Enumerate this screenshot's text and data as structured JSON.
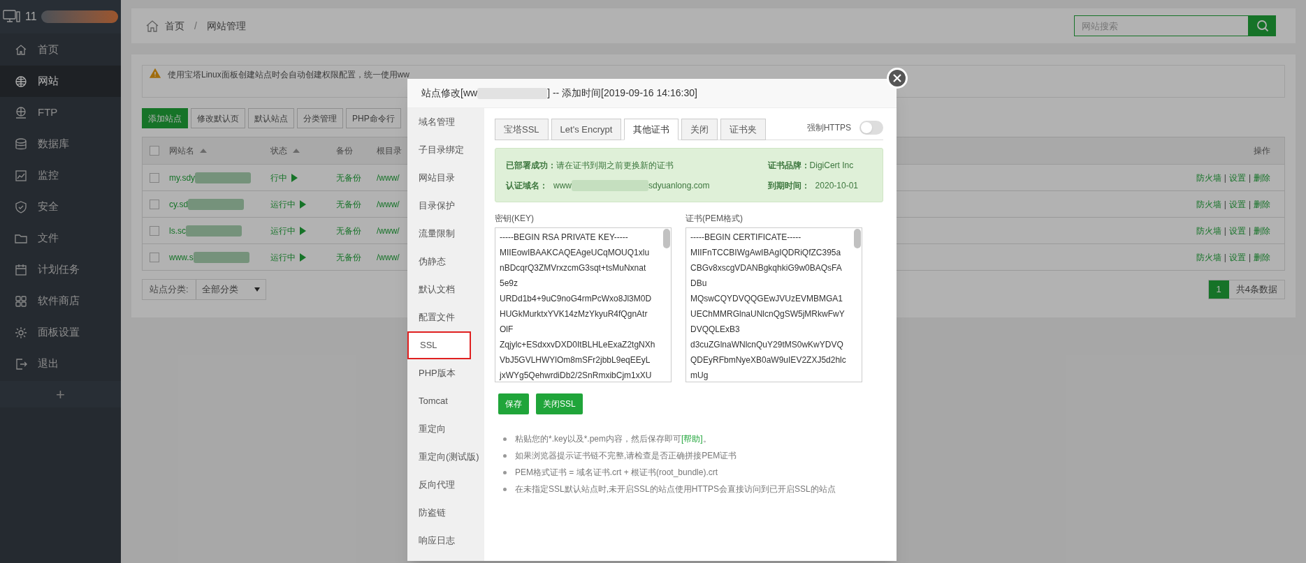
{
  "sidebar": {
    "host": "11",
    "items": [
      {
        "label": "首页",
        "selected": false
      },
      {
        "label": "网站",
        "selected": true
      },
      {
        "label": "FTP",
        "selected": false
      },
      {
        "label": "数据库",
        "selected": false
      },
      {
        "label": "监控",
        "selected": false
      },
      {
        "label": "安全",
        "selected": false
      },
      {
        "label": "文件",
        "selected": false
      },
      {
        "label": "计划任务",
        "selected": false
      },
      {
        "label": "软件商店",
        "selected": false
      },
      {
        "label": "面板设置",
        "selected": false
      },
      {
        "label": "退出",
        "selected": false
      }
    ],
    "add_button": "+"
  },
  "breadcrumb": {
    "items": [
      "首页",
      "网站管理"
    ],
    "separator": "/"
  },
  "search": {
    "placeholder": "网站搜索"
  },
  "notice": "使用宝塔Linux面板创建站点时会自动创建权限配置，统一使用ww",
  "toolbar": [
    {
      "label": "添加站点",
      "primary": true
    },
    {
      "label": "修改默认页",
      "primary": false
    },
    {
      "label": "默认站点",
      "primary": false
    },
    {
      "label": "分类管理",
      "primary": false
    },
    {
      "label": "PHP命令行",
      "primary": false
    }
  ],
  "table": {
    "columns": [
      {
        "label": "网站名",
        "sortable": true
      },
      {
        "label": "状态",
        "sortable": true
      },
      {
        "label": "备份",
        "sortable": false
      },
      {
        "label": "根目录",
        "sortable": false
      },
      {
        "label": "操作",
        "sortable": false
      }
    ],
    "action_separator": "|",
    "all_checked": false,
    "rows": [
      {
        "checked": false,
        "name": "my.sdy",
        "status": "行中",
        "backup": "无备份",
        "path": "/www/",
        "actions": [
          "防火墙",
          "设置",
          "删除"
        ]
      },
      {
        "checked": false,
        "name": "cy.sd",
        "status": "运行中",
        "backup": "无备份",
        "path": "/www/",
        "actions": [
          "防火墙",
          "设置",
          "删除"
        ]
      },
      {
        "checked": false,
        "name": "ls.sc",
        "status": "运行中",
        "backup": "无备份",
        "path": "/www/",
        "actions": [
          "防火墙",
          "设置",
          "删除"
        ]
      },
      {
        "checked": false,
        "name": "www.s",
        "status": "运行中",
        "backup": "无备份",
        "path": "/www/",
        "actions": [
          "防火墙",
          "设置",
          "删除"
        ]
      }
    ]
  },
  "category_filter": {
    "label": "站点分类:",
    "value": "全部分类"
  },
  "pagination": {
    "pages": [
      {
        "label": "1",
        "selected": true
      }
    ],
    "summary": "共4条数据"
  },
  "modal": {
    "title_prefix": "站点修改[ww",
    "title_suffix": "] -- 添加时间[2019-09-16 14:16:30]",
    "menu": [
      {
        "label": "域名管理",
        "selected": false
      },
      {
        "label": "子目录绑定",
        "selected": false
      },
      {
        "label": "网站目录",
        "selected": false
      },
      {
        "label": "目录保护",
        "selected": false
      },
      {
        "label": "流量限制",
        "selected": false
      },
      {
        "label": "伪静态",
        "selected": false
      },
      {
        "label": "默认文档",
        "selected": false
      },
      {
        "label": "配置文件",
        "selected": false
      },
      {
        "label": "SSL",
        "selected": true
      },
      {
        "label": "PHP版本",
        "selected": false
      },
      {
        "label": "Tomcat",
        "selected": false
      },
      {
        "label": "重定向",
        "selected": false
      },
      {
        "label": "重定向(测试版)",
        "selected": false
      },
      {
        "label": "反向代理",
        "selected": false
      },
      {
        "label": "防盗链",
        "selected": false
      },
      {
        "label": "响应日志",
        "selected": false
      }
    ],
    "tabs": [
      {
        "label": "宝塔SSL",
        "selected": false
      },
      {
        "label": "Let's Encrypt",
        "selected": false
      },
      {
        "label": "其他证书",
        "selected": true
      },
      {
        "label": "关闭",
        "selected": false
      },
      {
        "label": "证书夹",
        "selected": false
      }
    ],
    "force_https": {
      "label": "强制HTTPS",
      "on": false
    },
    "status": {
      "deployed_label": "已部署成功：",
      "deployed_text": "请在证书到期之前更换新的证书",
      "domain_label": "认证域名：",
      "domain_prefix": "www",
      "domain_suffix": "sdyuanlong.com",
      "brand_label": "证书品牌：",
      "brand": "DigiCert Inc",
      "expiry_label": "到期时间：",
      "expiry": "2020-10-01"
    },
    "key": {
      "label": "密钥(KEY)",
      "lines": [
        "-----BEGIN RSA PRIVATE KEY-----",
        "MIIEowIBAAKCAQEAgeUCqMOUQ1xlu",
        "nBDcqrQ3ZMVrxzcmG3sqt+tsMuNxnat",
        "5e9z",
        "URDd1b4+9uC9noG4rmPcWxo8Jl3M0D",
        "HUGkMurktxYVK14zMzYkyuR4fQgnAtr",
        "OlF",
        "Zqjylc+ESdxxvDXD0ItBLHLeExaZ2tgNXh",
        "VbJ5GVLHWYlOm8mSFr2jbbL9eqEEyL",
        "jxWYg5QehwrdiDb2/2SnRmxibCjm1xXU"
      ]
    },
    "cert": {
      "label": "证书(PEM格式)",
      "lines": [
        "-----BEGIN CERTIFICATE-----",
        "MIIFnTCCBIWgAwIBAgIQDRiQfZC395a",
        "CBGv8xscgVDANBgkqhkiG9w0BAQsFA",
        "DBu",
        "MQswCQYDVQQGEwJVUzEVMBMGA1",
        "UEChMMRGlnaUNlcnQgSW5jMRkwFwY",
        "DVQQLExB3",
        "d3cuZGlnaWNlcnQuY29tMS0wKwYDVQ",
        "QDEyRFbmNyeXB0aW9uIEV2ZXJ5d2hlc",
        "mUg"
      ]
    },
    "buttons": [
      "保存",
      "关闭SSL"
    ],
    "tips": [
      {
        "text": "粘贴您的*.key以及*.pem内容，然后保存即可",
        "link": "[帮助]",
        "after": "。"
      },
      {
        "text": "如果浏览器提示证书链不完整,请检查是否正确拼接PEM证书"
      },
      {
        "text": "PEM格式证书 = 域名证书.crt + 根证书(root_bundle).crt"
      },
      {
        "text": "在未指定SSL默认站点时,未开启SSL的站点使用HTTPS会直接访问到已开启SSL的站点"
      }
    ]
  }
}
